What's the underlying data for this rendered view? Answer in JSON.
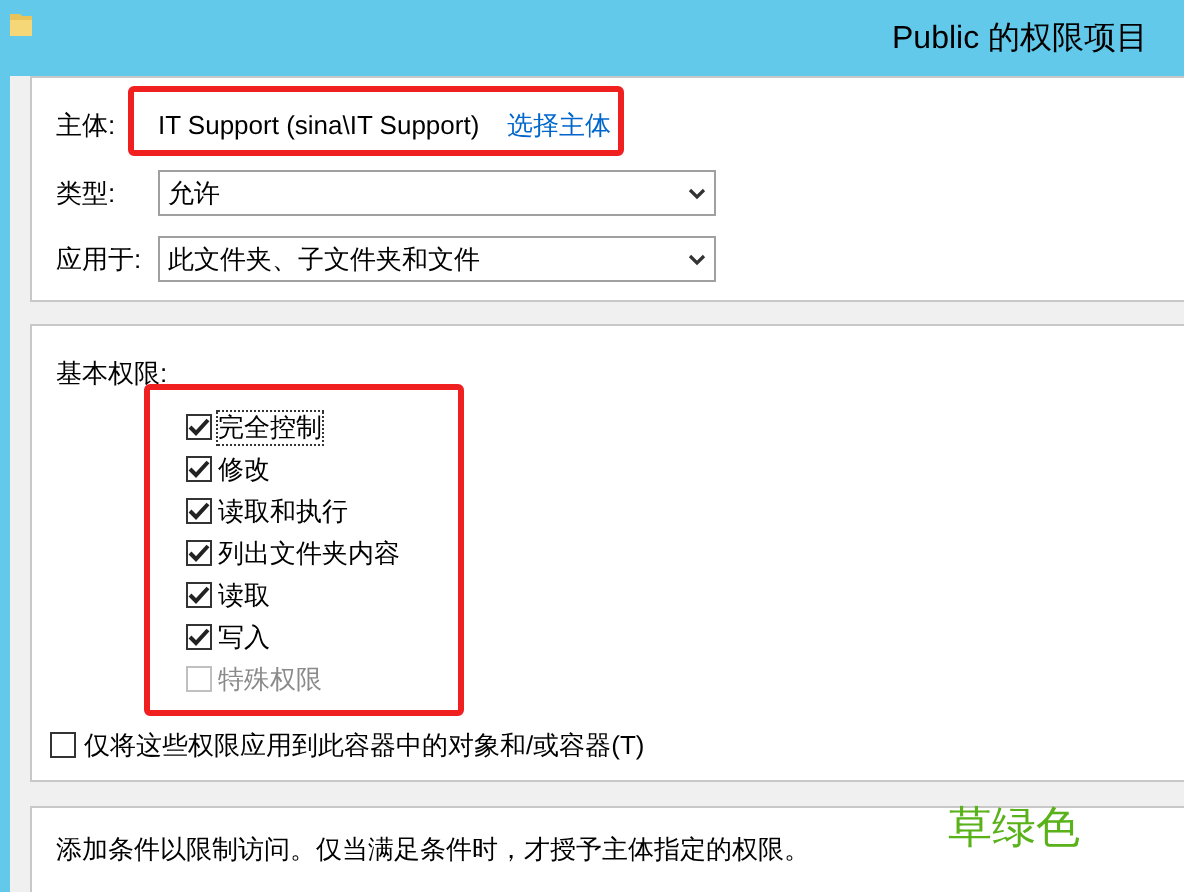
{
  "window": {
    "title": "Public 的权限项目"
  },
  "principal": {
    "label": "主体:",
    "value": "IT Support (sina\\IT Support)",
    "link": "选择主体"
  },
  "type": {
    "label": "类型:",
    "value": "允许"
  },
  "applies_to": {
    "label": "应用于:",
    "value": "此文件夹、子文件夹和文件"
  },
  "basic_permissions": {
    "label": "基本权限:",
    "items": [
      {
        "label": "完全控制",
        "checked": true,
        "disabled": false,
        "focused": true
      },
      {
        "label": "修改",
        "checked": true,
        "disabled": false,
        "focused": false
      },
      {
        "label": "读取和执行",
        "checked": true,
        "disabled": false,
        "focused": false
      },
      {
        "label": "列出文件夹内容",
        "checked": true,
        "disabled": false,
        "focused": false
      },
      {
        "label": "读取",
        "checked": true,
        "disabled": false,
        "focused": false
      },
      {
        "label": "写入",
        "checked": true,
        "disabled": false,
        "focused": false
      },
      {
        "label": "特殊权限",
        "checked": false,
        "disabled": true,
        "focused": false
      }
    ]
  },
  "apply_only": {
    "label": "仅将这些权限应用到此容器中的对象和/或容器(T)",
    "checked": false
  },
  "conditions": {
    "text": "添加条件以限制访问。仅当满足条件时，才授予主体指定的权限。"
  },
  "annotation": {
    "text": "草绿色"
  }
}
